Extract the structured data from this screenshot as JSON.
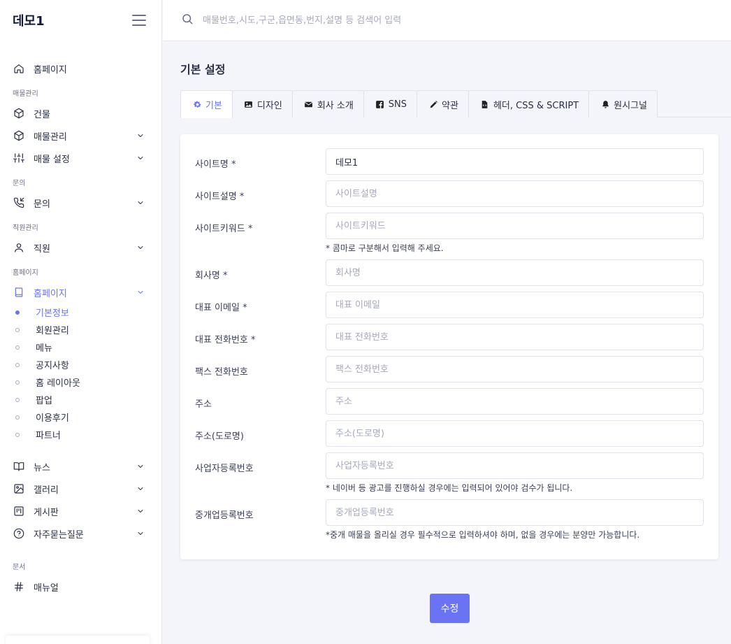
{
  "brand": "데모1",
  "search": {
    "placeholder": "매물번호,시도,구군,읍면동,번지,설명 등 검색어 입력"
  },
  "sidebar": {
    "home": "홈페이지",
    "sections": {
      "property": "매물관리",
      "inquiry": "문의",
      "staff": "직원관리",
      "homepage": "홈페이지",
      "docs": "문서"
    },
    "items": {
      "building": "건물",
      "property_mgmt": "매물관리",
      "property_settings": "매물 설정",
      "inquiry": "문의",
      "staff": "직원",
      "homepage": "홈페이지",
      "news": "뉴스",
      "gallery": "갤러리",
      "board": "게시판",
      "faq": "자주묻는질문",
      "manual": "매뉴얼"
    },
    "homepage_sub": [
      "기본정보",
      "회원관리",
      "메뉴",
      "공지사항",
      "홈 레이아웃",
      "팝업",
      "이용후기",
      "파트너"
    ]
  },
  "page": {
    "title": "기본 설정"
  },
  "tabs": [
    {
      "label": "기본",
      "icon": "gear-icon"
    },
    {
      "label": "디자인",
      "icon": "image-icon"
    },
    {
      "label": "회사 소개",
      "icon": "envelope-icon"
    },
    {
      "label": "SNS",
      "icon": "facebook-icon"
    },
    {
      "label": "약관",
      "icon": "pen-icon"
    },
    {
      "label": "헤더, CSS & SCRIPT",
      "icon": "code-file-icon"
    },
    {
      "label": "원시그널",
      "icon": "bell-icon"
    }
  ],
  "form": {
    "site_name": {
      "label": "사이트명 *",
      "value": "데모1",
      "placeholder": ""
    },
    "site_desc": {
      "label": "사이트설명 *",
      "value": "",
      "placeholder": "사이트설명"
    },
    "site_keywords": {
      "label": "사이트키워드 *",
      "value": "",
      "placeholder": "사이트키워드",
      "help": "* 콤마로 구분해서 입력해 주세요."
    },
    "company": {
      "label": "회사명 *",
      "value": "",
      "placeholder": "회사명"
    },
    "email": {
      "label": "대표 이메일 *",
      "value": "",
      "placeholder": "대표 이메일"
    },
    "phone": {
      "label": "대표 전화번호 *",
      "value": "",
      "placeholder": "대표 전화번호"
    },
    "fax": {
      "label": "팩스 전화번호",
      "value": "",
      "placeholder": "팩스 전화번호"
    },
    "address": {
      "label": "주소",
      "value": "",
      "placeholder": "주소"
    },
    "road_address": {
      "label": "주소(도로명)",
      "value": "",
      "placeholder": "주소(도로명)"
    },
    "biz_no": {
      "label": "사업자등록번호",
      "value": "",
      "placeholder": "사업자등록번호",
      "help": "* 네이버 등 광고를 진행하실 경우에는 입력되어 있어야 검수가 됩니다."
    },
    "broker_no": {
      "label": "중개업등록번호",
      "value": "",
      "placeholder": "중개업등록번호",
      "help": "*중개 매물을 올리실 경우 필수적으로 입력하셔야 하며, 없을 경우에는 분양만 가능합니다."
    }
  },
  "submit_label": "수정",
  "colors": {
    "accent": "#6b73f5",
    "background": "#f4f5fa"
  }
}
